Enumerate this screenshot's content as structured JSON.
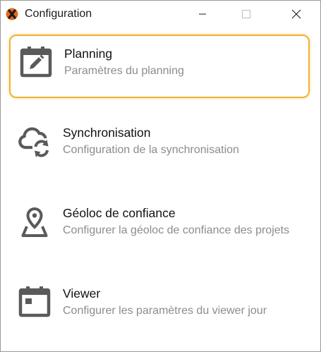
{
  "window": {
    "title": "Configuration",
    "app_icon": "app-logo-icon",
    "controls": {
      "minimize_icon": "minimize-icon",
      "maximize_icon": "maximize-icon",
      "close_icon": "close-icon"
    }
  },
  "colors": {
    "selection_border": "#f0b233",
    "icon_gray": "#5a5a5a",
    "description_gray": "#8c8c8c"
  },
  "items": [
    {
      "title": "Planning",
      "description": "Paramètres du planning",
      "icon": "calendar-edit-icon",
      "selected": true
    },
    {
      "title": "Synchronisation",
      "description": "Configuration de la synchronisation",
      "icon": "cloud-sync-icon",
      "selected": false
    },
    {
      "title": "Géoloc de confiance",
      "description": "Configurer la géoloc de confiance des projets",
      "icon": "map-pin-icon",
      "selected": false
    },
    {
      "title": "Viewer",
      "description": "Configurer les paramètres du viewer jour",
      "icon": "calendar-day-icon",
      "selected": false
    }
  ]
}
